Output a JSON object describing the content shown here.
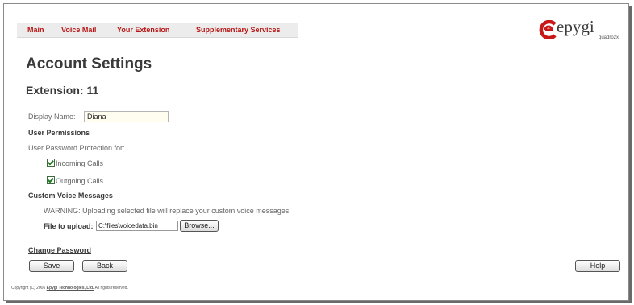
{
  "nav": {
    "items": [
      {
        "label": "Main"
      },
      {
        "label": "Voice Mail"
      },
      {
        "label": "Your Extension"
      },
      {
        "label": "Supplementary Services"
      }
    ]
  },
  "logo": {
    "brand": "epygi",
    "model": "quadro2x",
    "accent_color": "#c81818"
  },
  "page": {
    "title": "Account Settings",
    "extension": "Extension: 11"
  },
  "form": {
    "display_name_label": "Display Name:",
    "display_name_value": "Diana",
    "user_permissions": "User Permissions",
    "password_protection": "User Password Protection for:",
    "incoming_calls": {
      "label": "Incoming Calls",
      "checked": true
    },
    "outgoing_calls": {
      "label": "Outgoing Calls",
      "checked": true
    },
    "custom_voice_messages": "Custom Voice Messages",
    "warning": "WARNING: Uploading selected file will replace your custom voice messages.",
    "file_label": "File to upload:",
    "file_value": "C:\\files\\voicedata.bin",
    "browse_label": "Browse..."
  },
  "actions": {
    "change_password": "Change Password",
    "save": "Save",
    "back": "Back",
    "help": "Help"
  },
  "footer": {
    "prefix": "Copyright (C) 2006",
    "company": "Epygi Technologies, Ltd.",
    "suffix": "All rights reserved."
  }
}
